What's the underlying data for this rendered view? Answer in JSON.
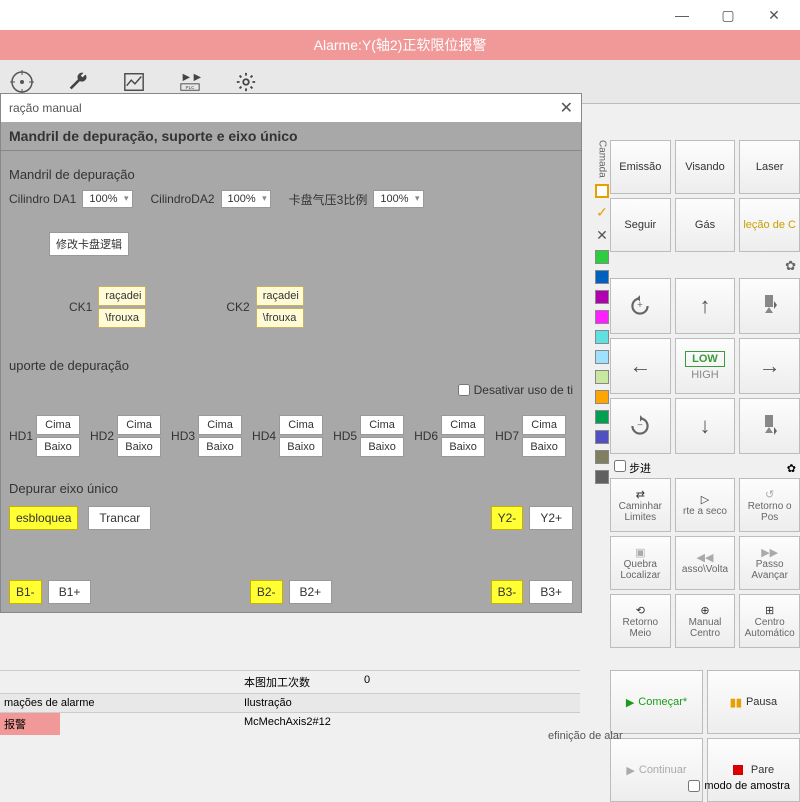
{
  "window": {
    "minimize": "—",
    "maximize": "▢",
    "close": "✕"
  },
  "alarm_bar": "Alarme:Y(轴2)正软限位报警",
  "dialog": {
    "title": "ração manual",
    "header": "Mandril de depuração, suporte e eixo único",
    "section_mandril": "Mandril de depuração",
    "cyl1_label": "Cilindro DA1",
    "cyl1_value": "100%",
    "cyl2_label": "CilindroDA2",
    "cyl2_value": "100%",
    "cyl3_label": "卡盘气压3比例",
    "cyl3_value": "100%",
    "modify_logic": "修改卡盘逻辑",
    "ck1": "CK1",
    "ck2": "CK2",
    "ck_btn1": "raçadei",
    "ck_btn2": "\\frouxa",
    "section_support": "uporte de depuração",
    "disable_use": "Desativar uso de ti",
    "hd_labels": [
      "HD1",
      "HD2",
      "HD3",
      "HD4",
      "HD5",
      "HD6",
      "HD7"
    ],
    "hd_up": "Cima",
    "hd_down": "Baixo",
    "section_axis": "Depurar eixo único",
    "unlock": "esbloquea",
    "lock": "Trancar",
    "y2_minus": "Y2-",
    "y2_plus": "Y2+",
    "b1_minus": "B1-",
    "b1_plus": "B1+",
    "b2_minus": "B2-",
    "b2_plus": "B2+",
    "b3_minus": "B3-",
    "b3_plus": "B3+"
  },
  "status": {
    "count_label": "本图加工次数",
    "count_value": "0",
    "alarm_info": "mações de alarme",
    "illustration": "Ilustração",
    "alarm_text": "报警",
    "axis_text": "McMechAxis2#12",
    "alarm_def": "efinição de alar"
  },
  "color_strip": {
    "camada": "Camada"
  },
  "right": {
    "emissao": "Emissão",
    "visando": "Visando",
    "laser": "Laser",
    "seguir": "Seguir",
    "gas": "Gás",
    "lecao": "leção de C",
    "low": "LOW",
    "high": "HIGH",
    "step": "步进",
    "caminhar": "Caminhar",
    "limites": "Limites",
    "rte_seco": "rte a seco",
    "retorno_pos": "Retorno o Pos",
    "quebra": "Quebra",
    "localizar": "Localizar",
    "asso_volta": "asso\\Volta",
    "passo_avancar": "Passo Avançar",
    "retorno_meio": "Retorno Meio",
    "manual_centro": "Manual Centro",
    "centro_auto": "Centro Automático",
    "comecar": "Começar*",
    "pausa": "Pausa",
    "continuar": "Continuar",
    "pare": "Pare",
    "sample_mode": "modo de amostra"
  }
}
